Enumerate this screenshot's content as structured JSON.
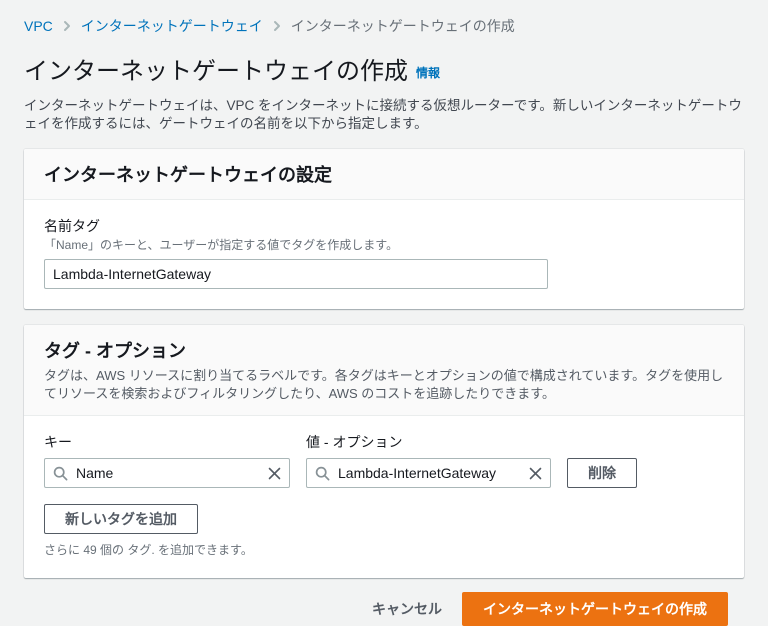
{
  "breadcrumb": {
    "items": [
      {
        "label": "VPC"
      },
      {
        "label": "インターネットゲートウェイ"
      },
      {
        "label": "インターネットゲートウェイの作成"
      }
    ]
  },
  "header": {
    "title": "インターネットゲートウェイの作成",
    "info_label": "情報",
    "description": "インターネットゲートウェイは、VPC をインターネットに接続する仮想ルーターです。新しいインターネットゲートウェイを作成するには、ゲートウェイの名前を以下から指定します。"
  },
  "settings_card": {
    "title": "インターネットゲートウェイの設定",
    "name_tag": {
      "label": "名前タグ",
      "help": "「Name」のキーと、ユーザーが指定する値でタグを作成します。",
      "value": "Lambda-InternetGateway"
    }
  },
  "tags_card": {
    "title": "タグ - オプション",
    "description": "タグは、AWS リソースに割り当てるラベルです。各タグはキーとオプションの値で構成されています。タグを使用してリソースを検索およびフィルタリングしたり、AWS のコストを追跡したりできます。",
    "key_label": "キー",
    "value_label": "値 - オプション",
    "tag_row": {
      "key": "Name",
      "value": "Lambda-InternetGateway"
    },
    "remove_button_label": "削除",
    "add_button_label": "新しいタグを追加",
    "remaining_note": "さらに 49 個の タグ. を追加できます。"
  },
  "footer": {
    "cancel_label": "キャンセル",
    "submit_label": "インターネットゲートウェイの作成"
  },
  "colors": {
    "primary_button": "#ec7211",
    "link": "#0073bb",
    "page_background": "#f2f3f3",
    "card_header_background": "#fafafa"
  }
}
